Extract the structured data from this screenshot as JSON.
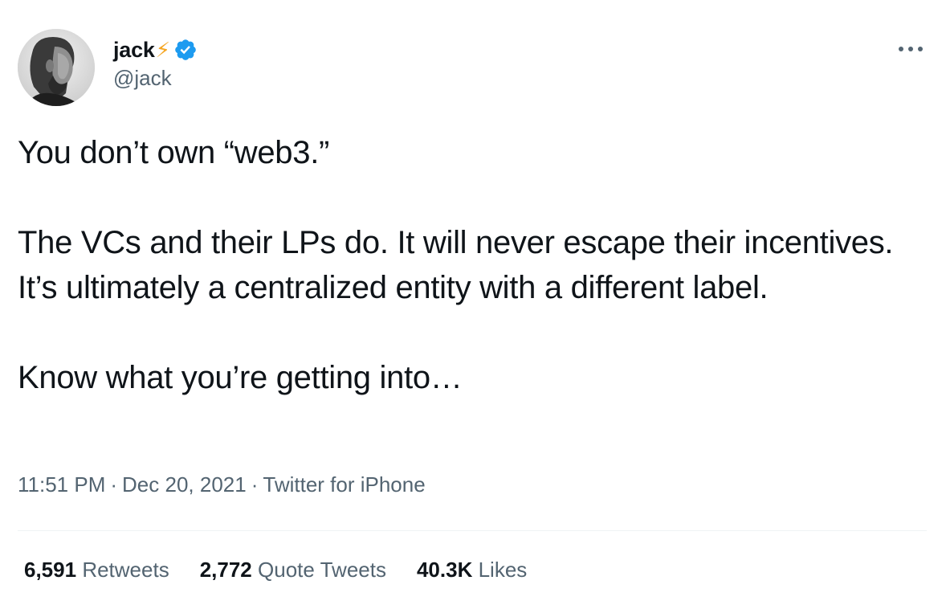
{
  "author": {
    "display_name": "jack",
    "name_emoji": "⚡",
    "handle": "@jack",
    "verified": true,
    "verified_color": "#1d9bf0"
  },
  "more_icon": "more-horizontal-icon",
  "tweet": {
    "paragraphs": [
      "You don’t own “web3.”",
      "The VCs and their LPs do. It will never escape their incentives. It’s ultimately a centralized entity with a different label.",
      "Know what you’re getting into…"
    ]
  },
  "meta": {
    "time": "11:51 PM",
    "date": "Dec 20, 2021",
    "separator": "·",
    "source": "Twitter for iPhone"
  },
  "stats": {
    "retweets": {
      "count": "6,591",
      "label": "Retweets"
    },
    "quotes": {
      "count": "2,772",
      "label": "Quote Tweets"
    },
    "likes": {
      "count": "40.3K",
      "label": "Likes"
    }
  },
  "colors": {
    "text": "#0f1419",
    "secondary": "#536471",
    "divider": "#eff3f4",
    "bolt": "#f5a623"
  }
}
